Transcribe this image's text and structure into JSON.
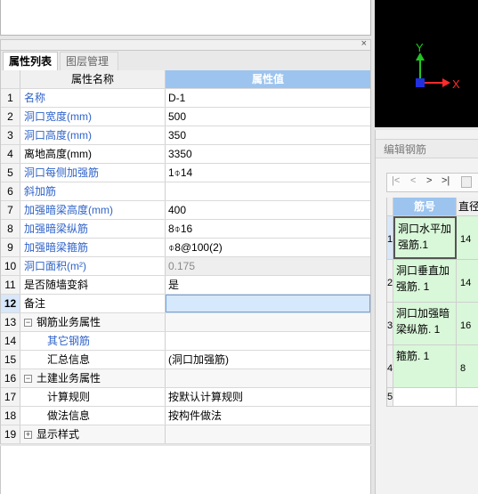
{
  "tabs": {
    "props": "属性列表",
    "layers": "图层管理"
  },
  "close_glyph": "×",
  "grid_header": {
    "name": "属性名称",
    "value": "属性值"
  },
  "rows": [
    {
      "num": "1",
      "name": "名称",
      "value": "D-1",
      "blue": true
    },
    {
      "num": "2",
      "name": "洞口宽度(mm)",
      "value": "500",
      "blue": true
    },
    {
      "num": "3",
      "name": "洞口高度(mm)",
      "value": "350",
      "blue": true
    },
    {
      "num": "4",
      "name": "离地高度(mm)",
      "value": "3350",
      "blue": false
    },
    {
      "num": "5",
      "name": "洞口每侧加强筋",
      "value": "1⌽14",
      "blue": true
    },
    {
      "num": "6",
      "name": "斜加筋",
      "value": "",
      "blue": true
    },
    {
      "num": "7",
      "name": "加强暗梁高度(mm)",
      "value": "400",
      "blue": true
    },
    {
      "num": "8",
      "name": "加强暗梁纵筋",
      "value": "8⌽16",
      "blue": true
    },
    {
      "num": "9",
      "name": "加强暗梁箍筋",
      "value": "⌽8@100(2)",
      "blue": true
    },
    {
      "num": "10",
      "name": "洞口面积(m²)",
      "value": "0.175",
      "blue": true
    },
    {
      "num": "11",
      "name": "是否随墙变斜",
      "value": "是",
      "blue": false
    },
    {
      "num": "12",
      "name": "备注",
      "value": "",
      "blue": false
    },
    {
      "num": "13",
      "name": "钢筋业务属性",
      "value": "",
      "blue": false
    },
    {
      "num": "14",
      "name": "其它钢筋",
      "value": "",
      "blue": true
    },
    {
      "num": "15",
      "name": "汇总信息",
      "value": "(洞口加强筋)",
      "blue": false
    },
    {
      "num": "16",
      "name": "土建业务属性",
      "value": "",
      "blue": false
    },
    {
      "num": "17",
      "name": "计算规则",
      "value": "按默认计算规则",
      "blue": false
    },
    {
      "num": "18",
      "name": "做法信息",
      "value": "按构件做法",
      "blue": false
    },
    {
      "num": "19",
      "name": "显示样式",
      "value": "",
      "blue": false
    }
  ],
  "tree_collapse_glyph": "−",
  "tree_expand_glyph": "+",
  "axes": {
    "x": "X",
    "y": "Y",
    "x_color": "#ff2a2a",
    "y_color": "#22c522",
    "origin_color": "#2030e0"
  },
  "rebar": {
    "title": "编辑钢筋",
    "nav": {
      "first": "|<",
      "prev": "<",
      "next": ">",
      "last": ">|"
    },
    "header": {
      "name": "筋号",
      "dia": "直径"
    },
    "rows": [
      {
        "num": "1",
        "name": "洞口水平加强筋.1",
        "dia": "14"
      },
      {
        "num": "2",
        "name": "洞口垂直加强筋. 1",
        "dia": "14"
      },
      {
        "num": "3",
        "name": "洞口加强暗梁纵筋. 1",
        "dia": "16"
      },
      {
        "num": "4",
        "name": "箍筋. 1",
        "dia": "8"
      },
      {
        "num": "5",
        "name": "",
        "dia": ""
      }
    ]
  }
}
